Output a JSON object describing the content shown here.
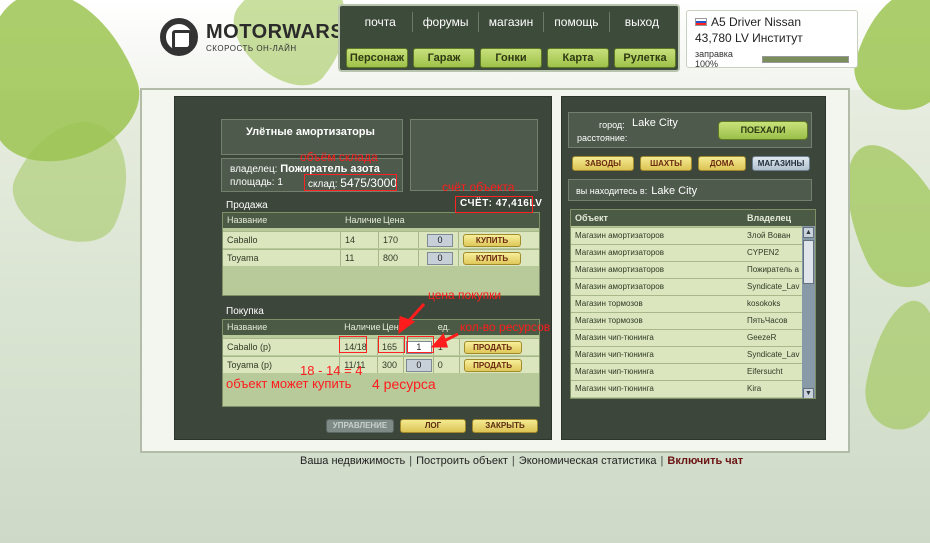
{
  "logo": {
    "title": "MOTORWARS.RU",
    "subtitle": "СКОРОСТЬ ОН-ЛАЙН"
  },
  "menu": {
    "top_links": [
      "почта",
      "форумы",
      "магазин",
      "помощь",
      "выход"
    ],
    "buttons": [
      "Персонаж",
      "Гараж",
      "Гонки",
      "Карта",
      "Рулетка"
    ]
  },
  "player": {
    "name": "A5 Driver Nissan",
    "money": "43,780 LV Институт",
    "fuel_label": "заправка 100%",
    "fuel_percent": 100
  },
  "object": {
    "title": "Улётные амортизаторы",
    "owner_label": "владелец:",
    "owner": "Пожиратель азота",
    "area_label": "площадь:",
    "area": "1",
    "sklad_label": "склад:",
    "sklad": "5475/3000",
    "account": "СЧЁТ: 47,416LV"
  },
  "sale": {
    "label": "Продажа",
    "headers": [
      "Название",
      "Наличие",
      "Цена"
    ],
    "rows": [
      {
        "name": "Caballo",
        "stock": "14",
        "price": "170",
        "qty": "0",
        "action": "КУПИТЬ"
      },
      {
        "name": "Toyama",
        "stock": "11",
        "price": "800",
        "qty": "0",
        "action": "КУПИТЬ"
      }
    ]
  },
  "purchase": {
    "label": "Покупка",
    "headers": [
      "Название",
      "Наличие",
      "Цена",
      "ед."
    ],
    "rows": [
      {
        "name": "Caballo (p)",
        "stock": "14/18",
        "price": "165",
        "qty": "1",
        "unit": "1",
        "action": "ПРОДАТЬ"
      },
      {
        "name": "Toyama (p)",
        "stock": "11/11",
        "price": "300",
        "qty": "0",
        "unit": "0",
        "action": "ПРОДАТЬ"
      }
    ]
  },
  "bottom_buttons": [
    "УПРАВЛЕНИЕ",
    "ЛОГ",
    "ЗАКРЫТЬ"
  ],
  "city": {
    "city_label": "город:",
    "city": "Lake City",
    "distance_label": "расстояние:",
    "go_button": "ПОЕХАЛИ",
    "tabs": [
      "ЗАВОДЫ",
      "ШАХТЫ",
      "ДОМА",
      "МАГАЗИНЫ"
    ],
    "location_label": "вы находитесь в:",
    "location": "Lake City"
  },
  "object_list": {
    "headers": [
      "Объект",
      "Владелец"
    ],
    "rows": [
      {
        "object": "Магазин амортизаторов",
        "owner": "Злой Вован"
      },
      {
        "object": "Магазин амортизаторов",
        "owner": "CYPEN2"
      },
      {
        "object": "Магазин амортизаторов",
        "owner": "Пожиратель а"
      },
      {
        "object": "Магазин амортизаторов",
        "owner": "Syndicate_Lav"
      },
      {
        "object": "Магазин тормозов",
        "owner": "kosokoks"
      },
      {
        "object": "Магазин тормозов",
        "owner": "ПятьЧасов"
      },
      {
        "object": "Магазин чип-тюнинга",
        "owner": "GeezeR"
      },
      {
        "object": "Магазин чип-тюнинга",
        "owner": "Syndicate_Lav"
      },
      {
        "object": "Магазин чип-тюнинга",
        "owner": "Eifersucht"
      },
      {
        "object": "Магазин чип-тюнинга",
        "owner": "Kira"
      }
    ]
  },
  "footer": {
    "links": [
      "Ваша недвижимость",
      "Построить объект",
      "Экономическая статистика"
    ],
    "last_link": "Включить чат",
    "separator": "|"
  },
  "annotations": {
    "storage": "объём склада",
    "account": "счёт объекта",
    "purchase_price": "цена покупки",
    "resource_count": "кол-во ресурсов",
    "calc": "18 - 14 = 4",
    "can_buy_1": "объект может купить",
    "can_buy_2": "4 ресурса"
  },
  "colors": {
    "panel_dark": "#3c463a",
    "table_green": "#dbe6bf",
    "accent_green": "#9fc24a",
    "button_yellow": "#e0c85a",
    "annotation_red": "#ff1c1c"
  }
}
